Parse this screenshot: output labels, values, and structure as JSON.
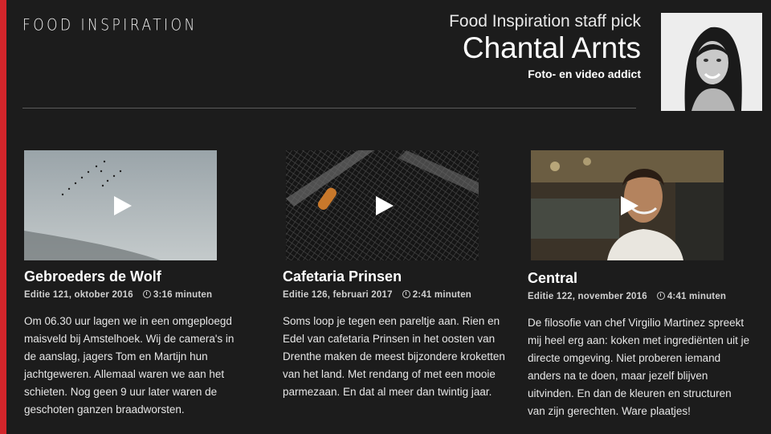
{
  "brand": {
    "logo_text": "FOOD INSPIRATION",
    "accent": "#d3252b"
  },
  "header": {
    "kicker": "Food Inspiration staff pick",
    "name": "Chantal Arnts",
    "tagline": "Foto- en video addict"
  },
  "cards": [
    {
      "title": "Gebroeders de Wolf",
      "edition": "Editie 121, oktober 2016",
      "duration": "3:16 minuten",
      "description": "Om 06.30 uur lagen we in een omgeploegd maisveld bij Amstelhoek. Wij de camera's in de aanslag, jagers Tom en Martijn hun jachtgeweren. Allemaal waren we aan het schieten. Nog geen 9 uur later waren de geschoten ganzen braadworsten."
    },
    {
      "title": "Cafetaria Prinsen",
      "edition": "Editie 126, februari 2017",
      "duration": "2:41 minuten",
      "description": "Soms loop je tegen een pareltje aan. Rien en Edel van cafetaria Prinsen in het oosten van Drenthe maken de meest bijzondere kroketten van het land. Met rendang of met een mooie parmezaan. En dat al meer dan twintig jaar."
    },
    {
      "title": "Central",
      "edition": "Editie 122, november 2016",
      "duration": "4:41 minuten",
      "description": "De filosofie van chef Virgilio Martinez spreekt mij heel erg aan: koken met ingrediënten uit je directe omgeving. Niet proberen iemand anders na te doen, maar jezelf blijven uitvinden. En dan de kleuren en structuren van zijn gerechten. Ware plaatjes!"
    }
  ]
}
